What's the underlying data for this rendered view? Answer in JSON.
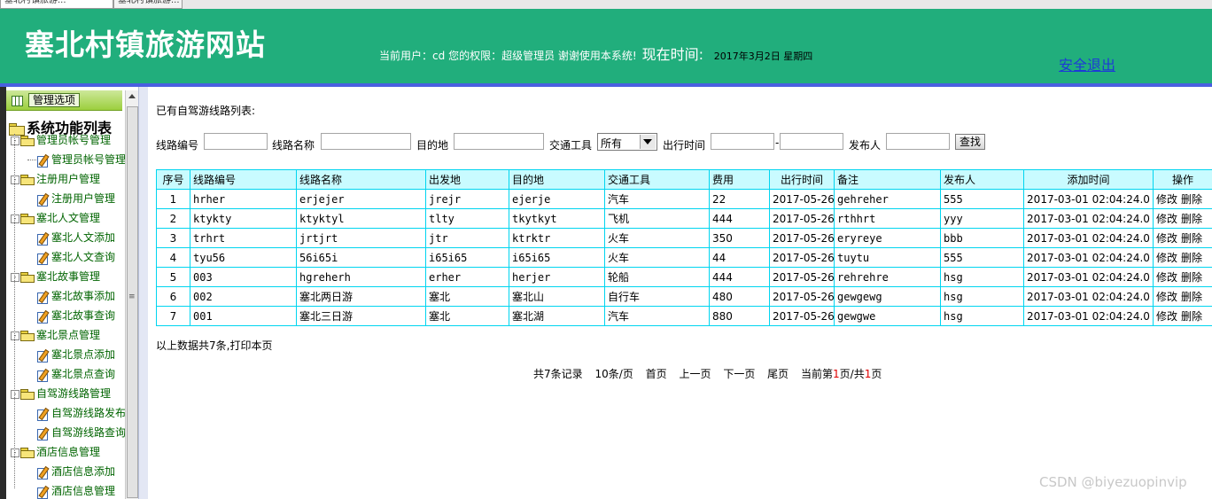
{
  "browser_tabs": [
    "塞北村镇旅游...",
    "塞北村镇旅游..."
  ],
  "header": {
    "site_title": "塞北村镇旅游网站",
    "current_user_label": "当前用户：",
    "current_user": "cd",
    "permission_label": "您的权限：",
    "permission": "超级管理员",
    "thanks": "谢谢使用本系统!",
    "time_label": "现在时间:",
    "date": "2017年3月2日 星期四",
    "logout": "安全退出"
  },
  "sidebar": {
    "options_button": "管理选项",
    "root": "系统功能列表",
    "groups": [
      {
        "label": "管理员帐号管理",
        "children": [
          "管理员帐号管理"
        ]
      },
      {
        "label": "注册用户管理",
        "children": [
          "注册用户管理"
        ]
      },
      {
        "label": "塞北人文管理",
        "children": [
          "塞北人文添加",
          "塞北人文查询"
        ]
      },
      {
        "label": "塞北故事管理",
        "children": [
          "塞北故事添加",
          "塞北故事查询"
        ]
      },
      {
        "label": "塞北景点管理",
        "children": [
          "塞北景点添加",
          "塞北景点查询"
        ]
      },
      {
        "label": "自驾游线路管理",
        "children": [
          "自驾游线路发布",
          "自驾游线路查询"
        ]
      },
      {
        "label": "酒店信息管理",
        "children": [
          "酒店信息添加",
          "酒店信息管理"
        ]
      }
    ]
  },
  "main": {
    "list_title": "已有自驾游线路列表:",
    "search": {
      "route_no_label": "线路编号",
      "route_name_label": "线路名称",
      "destination_label": "目的地",
      "transport_label": "交通工具",
      "transport_value": "所有",
      "depart_time_label": "出行时间",
      "range_sep": "-",
      "publisher_label": "发布人",
      "search_button": "查找"
    },
    "table": {
      "headers": [
        "序号",
        "线路编号",
        "线路名称",
        "出发地",
        "目的地",
        "交通工具",
        "费用",
        "出行时间",
        "备注",
        "发布人",
        "添加时间",
        "操作"
      ],
      "rows": [
        [
          "1",
          "hrher",
          "erjejer",
          "jrejr",
          "ejerje",
          "汽车",
          "22",
          "2017-05-26",
          "gehreher",
          "555",
          "2017-03-01 02:04:24.0"
        ],
        [
          "2",
          "ktykty",
          "ktyktyl",
          "tlty",
          "tkytkyt",
          "飞机",
          "444",
          "2017-05-26",
          "rthhrt",
          "yyy",
          "2017-03-01 02:04:24.0"
        ],
        [
          "3",
          "trhrt",
          "jrtjrt",
          "jtr",
          "ktrktr",
          "火车",
          "350",
          "2017-05-26",
          "eryreye",
          "bbb",
          "2017-03-01 02:04:24.0"
        ],
        [
          "4",
          "tyu56",
          "56i65i",
          "i65i65",
          "i65i65",
          "火车",
          "44",
          "2017-05-26",
          "tuytu",
          "555",
          "2017-03-01 02:04:24.0"
        ],
        [
          "5",
          "003",
          "hgreherh",
          "erher",
          "herjer",
          "轮船",
          "444",
          "2017-05-26",
          "rehrehre",
          "hsg",
          "2017-03-01 02:04:24.0"
        ],
        [
          "6",
          "002",
          "塞北两日游",
          "塞北",
          "塞北山",
          "自行车",
          "480",
          "2017-05-26",
          "gewgewg",
          "hsg",
          "2017-03-01 02:04:24.0"
        ],
        [
          "7",
          "001",
          "塞北三日游",
          "塞北",
          "塞北湖",
          "汽车",
          "880",
          "2017-05-26",
          "gewgwe",
          "hsg",
          "2017-03-01 02:04:24.0"
        ]
      ],
      "edit_label": "修改",
      "delete_label": "删除"
    },
    "summary": "以上数据共7条,打印本页",
    "pager": {
      "total": "共7条记录",
      "per_page": "10条/页",
      "first": "首页",
      "prev": "上一页",
      "next": "下一页",
      "last": "尾页",
      "current_prefix": "当前第",
      "current_page": "1",
      "current_mid": "页/共",
      "total_pages": "1",
      "current_suffix": "页"
    }
  },
  "watermark": "CSDN @biyezuopinvip",
  "colors": {
    "header_bg": "#21ae7c",
    "header_border": "#4a5fe0",
    "table_border": "#00d5f0",
    "table_header_bg": "#c9fbff"
  }
}
